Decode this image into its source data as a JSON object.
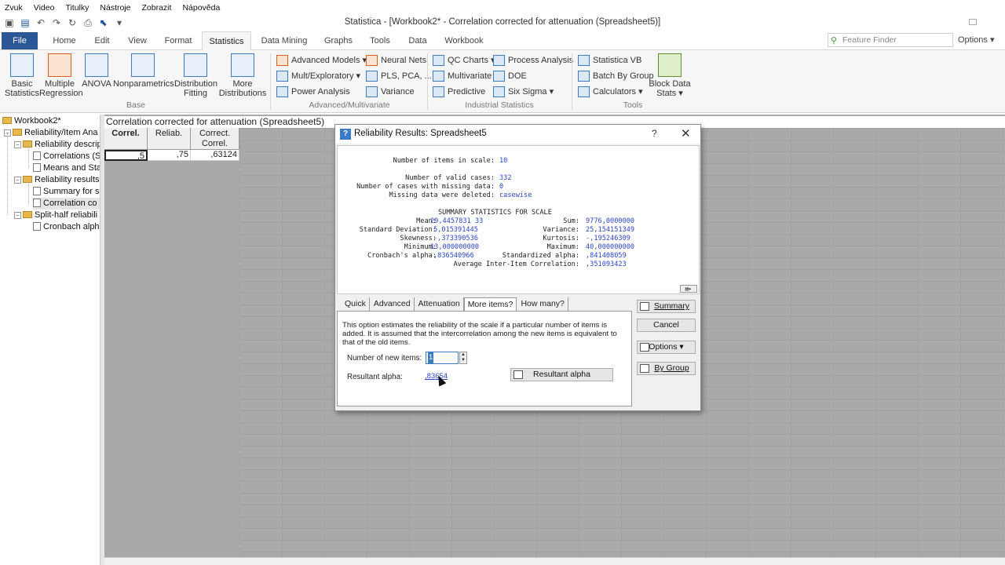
{
  "menubar": [
    "Zvuk",
    "Video",
    "Titulky",
    "Nástroje",
    "Zobrazit",
    "Nápověda"
  ],
  "app": {
    "title": "Statistica - [Workbook2* - Correlation corrected for attenuation (Spreadsheet5)]"
  },
  "ribbon_tabs": [
    "File",
    "Home",
    "Edit",
    "View",
    "Format",
    "Statistics",
    "Data Mining",
    "Graphs",
    "Tools",
    "Data",
    "Workbook"
  ],
  "active_tab": "Statistics",
  "feature_finder": {
    "placeholder": "Feature Finder"
  },
  "options_label": "Options",
  "ribbon": {
    "base": {
      "label": "Base",
      "buttons": [
        {
          "l1": "Basic",
          "l2": "Statistics",
          "icon": "basic-statistics-icon"
        },
        {
          "l1": "Multiple",
          "l2": "Regression",
          "icon": "regression-icon"
        },
        {
          "l1": "ANOVA",
          "l2": "",
          "icon": "anova-icon"
        },
        {
          "l1": "Nonparametrics",
          "l2": "",
          "icon": "nonparametrics-icon"
        },
        {
          "l1": "Distribution",
          "l2": "Fitting",
          "icon": "distribution-icon"
        },
        {
          "l1": "More",
          "l2": "Distributions",
          "icon": "more-distributions-icon"
        }
      ]
    },
    "advanced": {
      "label": "Advanced/Multivariate",
      "items": [
        "Advanced Models ▾",
        "Neural Nets",
        "Mult/Exploratory ▾",
        "PLS, PCA, ...",
        "Power Analysis",
        "Variance"
      ]
    },
    "industrial": {
      "label": "Industrial Statistics",
      "items": [
        "QC Charts ▾",
        "Process Analysis",
        "Multivariate",
        "DOE",
        "Predictive",
        "Six Sigma ▾"
      ]
    },
    "tools": {
      "label": "Tools",
      "items": [
        "Statistica VB",
        "Batch By Group",
        "Calculators ▾"
      ],
      "block": {
        "l1": "Block Data",
        "l2": "Stats ▾"
      }
    }
  },
  "tree": [
    "Workbook2*",
    "Reliability/Item Ana",
    "Reliability descrip",
    "Correlations (S",
    "Means and Sta",
    "Reliability results",
    "Summary for s",
    "Correlation co",
    "Split-half reliabili",
    "Cronbach alph"
  ],
  "sheet": {
    "title": "Correlation corrected for attenuation (Spreadsheet5)",
    "headers": [
      "Correl.",
      "Reliab.",
      "Correct.\nCorrel."
    ],
    "values": [
      ",5",
      ",75",
      ",63124"
    ]
  },
  "dialog": {
    "title": "Reliability Results: Spreadsheet5",
    "help": "?",
    "close": "✕",
    "output": {
      "n_items_label": "Number of items in scale:",
      "n_items": "10",
      "valid_label": "Number of valid cases:",
      "valid": "332",
      "missing_label": "Number of cases with missing data:",
      "missing": "0",
      "deleted_label": "Missing data were deleted:",
      "deleted": "casewise",
      "summary_title": "SUMMARY STATISTICS FOR SCALE",
      "mean_label": "Mean:",
      "mean": "29,4457831 33",
      "sum_label": "Sum:",
      "sum": "9776,0000000",
      "sd_label": "Standard Deviation:",
      "sd": "5,015391445",
      "var_label": "Variance:",
      "var": "25,154151349",
      "skew_label": "Skewness:",
      "skew": "-,373390536",
      "kurt_label": "Kurtosis:",
      "kurt": "-,195246309",
      "min_label": "Minimum:",
      "min": "13,000000000",
      "max_label": "Maximum:",
      "max": "40,000000000",
      "alpha_label": "Cronbach's alpha:",
      "alpha": ",836540966",
      "std_alpha_label": "Standardized alpha:",
      "std_alpha": ",841408059",
      "avg_r_label": "Average Inter-Item Correlation:",
      "avg_r": ",351093423"
    },
    "tabs": [
      "Quick",
      "Advanced",
      "Attenuation",
      "More items?",
      "How many?"
    ],
    "active_tab": "More items?",
    "panel": {
      "description": "This option estimates the reliability of the scale if a particular number of items is added. It is assumed that the intercorrelation among the new items is equivalent to that of the old items.",
      "new_items_label": "Number of new items:",
      "new_items_value": "1",
      "resultant_label": "Resultant alpha:",
      "resultant_value": ",83654",
      "resultant_button": "Resultant alpha"
    },
    "buttons": {
      "summary": "Summary",
      "cancel": "Cancel",
      "options": "Options",
      "bygroup": "By Group"
    }
  }
}
